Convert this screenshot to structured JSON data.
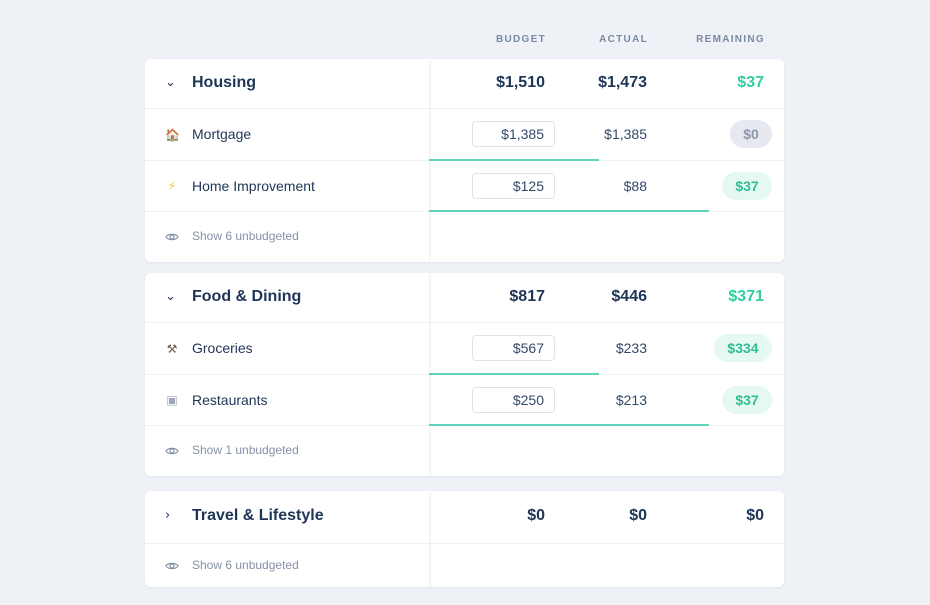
{
  "columns": {
    "budget": "BUDGET",
    "actual": "ACTUAL",
    "remaining": "REMAINING"
  },
  "colors": {
    "accent_green": "#2fcfa2",
    "progress": "#5fd6bc",
    "text_dark": "#1f3557"
  },
  "groups": [
    {
      "title": "Housing",
      "expanded": true,
      "chevron": "chevron-down-icon",
      "budget": "$1,510",
      "actual": "$1,473",
      "remaining": "$37",
      "items": [
        {
          "label": "Mortgage",
          "icon": "house-icon",
          "budget": "$1,385",
          "actual": "$1,385",
          "remaining": "$0",
          "remaining_status": "zero",
          "spent_fraction": 0.48
        },
        {
          "label": "Home Improvement",
          "icon": "lightning-icon",
          "budget": "$125",
          "actual": "$88",
          "remaining": "$37",
          "remaining_status": "positive",
          "spent_fraction": 0.79
        }
      ],
      "unbudgeted": "Show 6 unbudgeted"
    },
    {
      "title": "Food & Dining",
      "expanded": true,
      "chevron": "chevron-down-icon",
      "budget": "$817",
      "actual": "$446",
      "remaining": "$371",
      "items": [
        {
          "label": "Groceries",
          "icon": "hammer-icon",
          "budget": "$567",
          "actual": "$233",
          "remaining": "$334",
          "remaining_status": "positive",
          "spent_fraction": 0.48
        },
        {
          "label": "Restaurants",
          "icon": "plate-icon",
          "budget": "$250",
          "actual": "$213",
          "remaining": "$37",
          "remaining_status": "positive",
          "spent_fraction": 0.79
        }
      ],
      "unbudgeted": "Show 1 unbudgeted"
    },
    {
      "title": "Travel & Lifestyle",
      "expanded": false,
      "chevron": "chevron-right-icon",
      "budget": "$0",
      "actual": "$0",
      "remaining": "$0",
      "items": [],
      "unbudgeted": "Show 6 unbudgeted"
    }
  ]
}
